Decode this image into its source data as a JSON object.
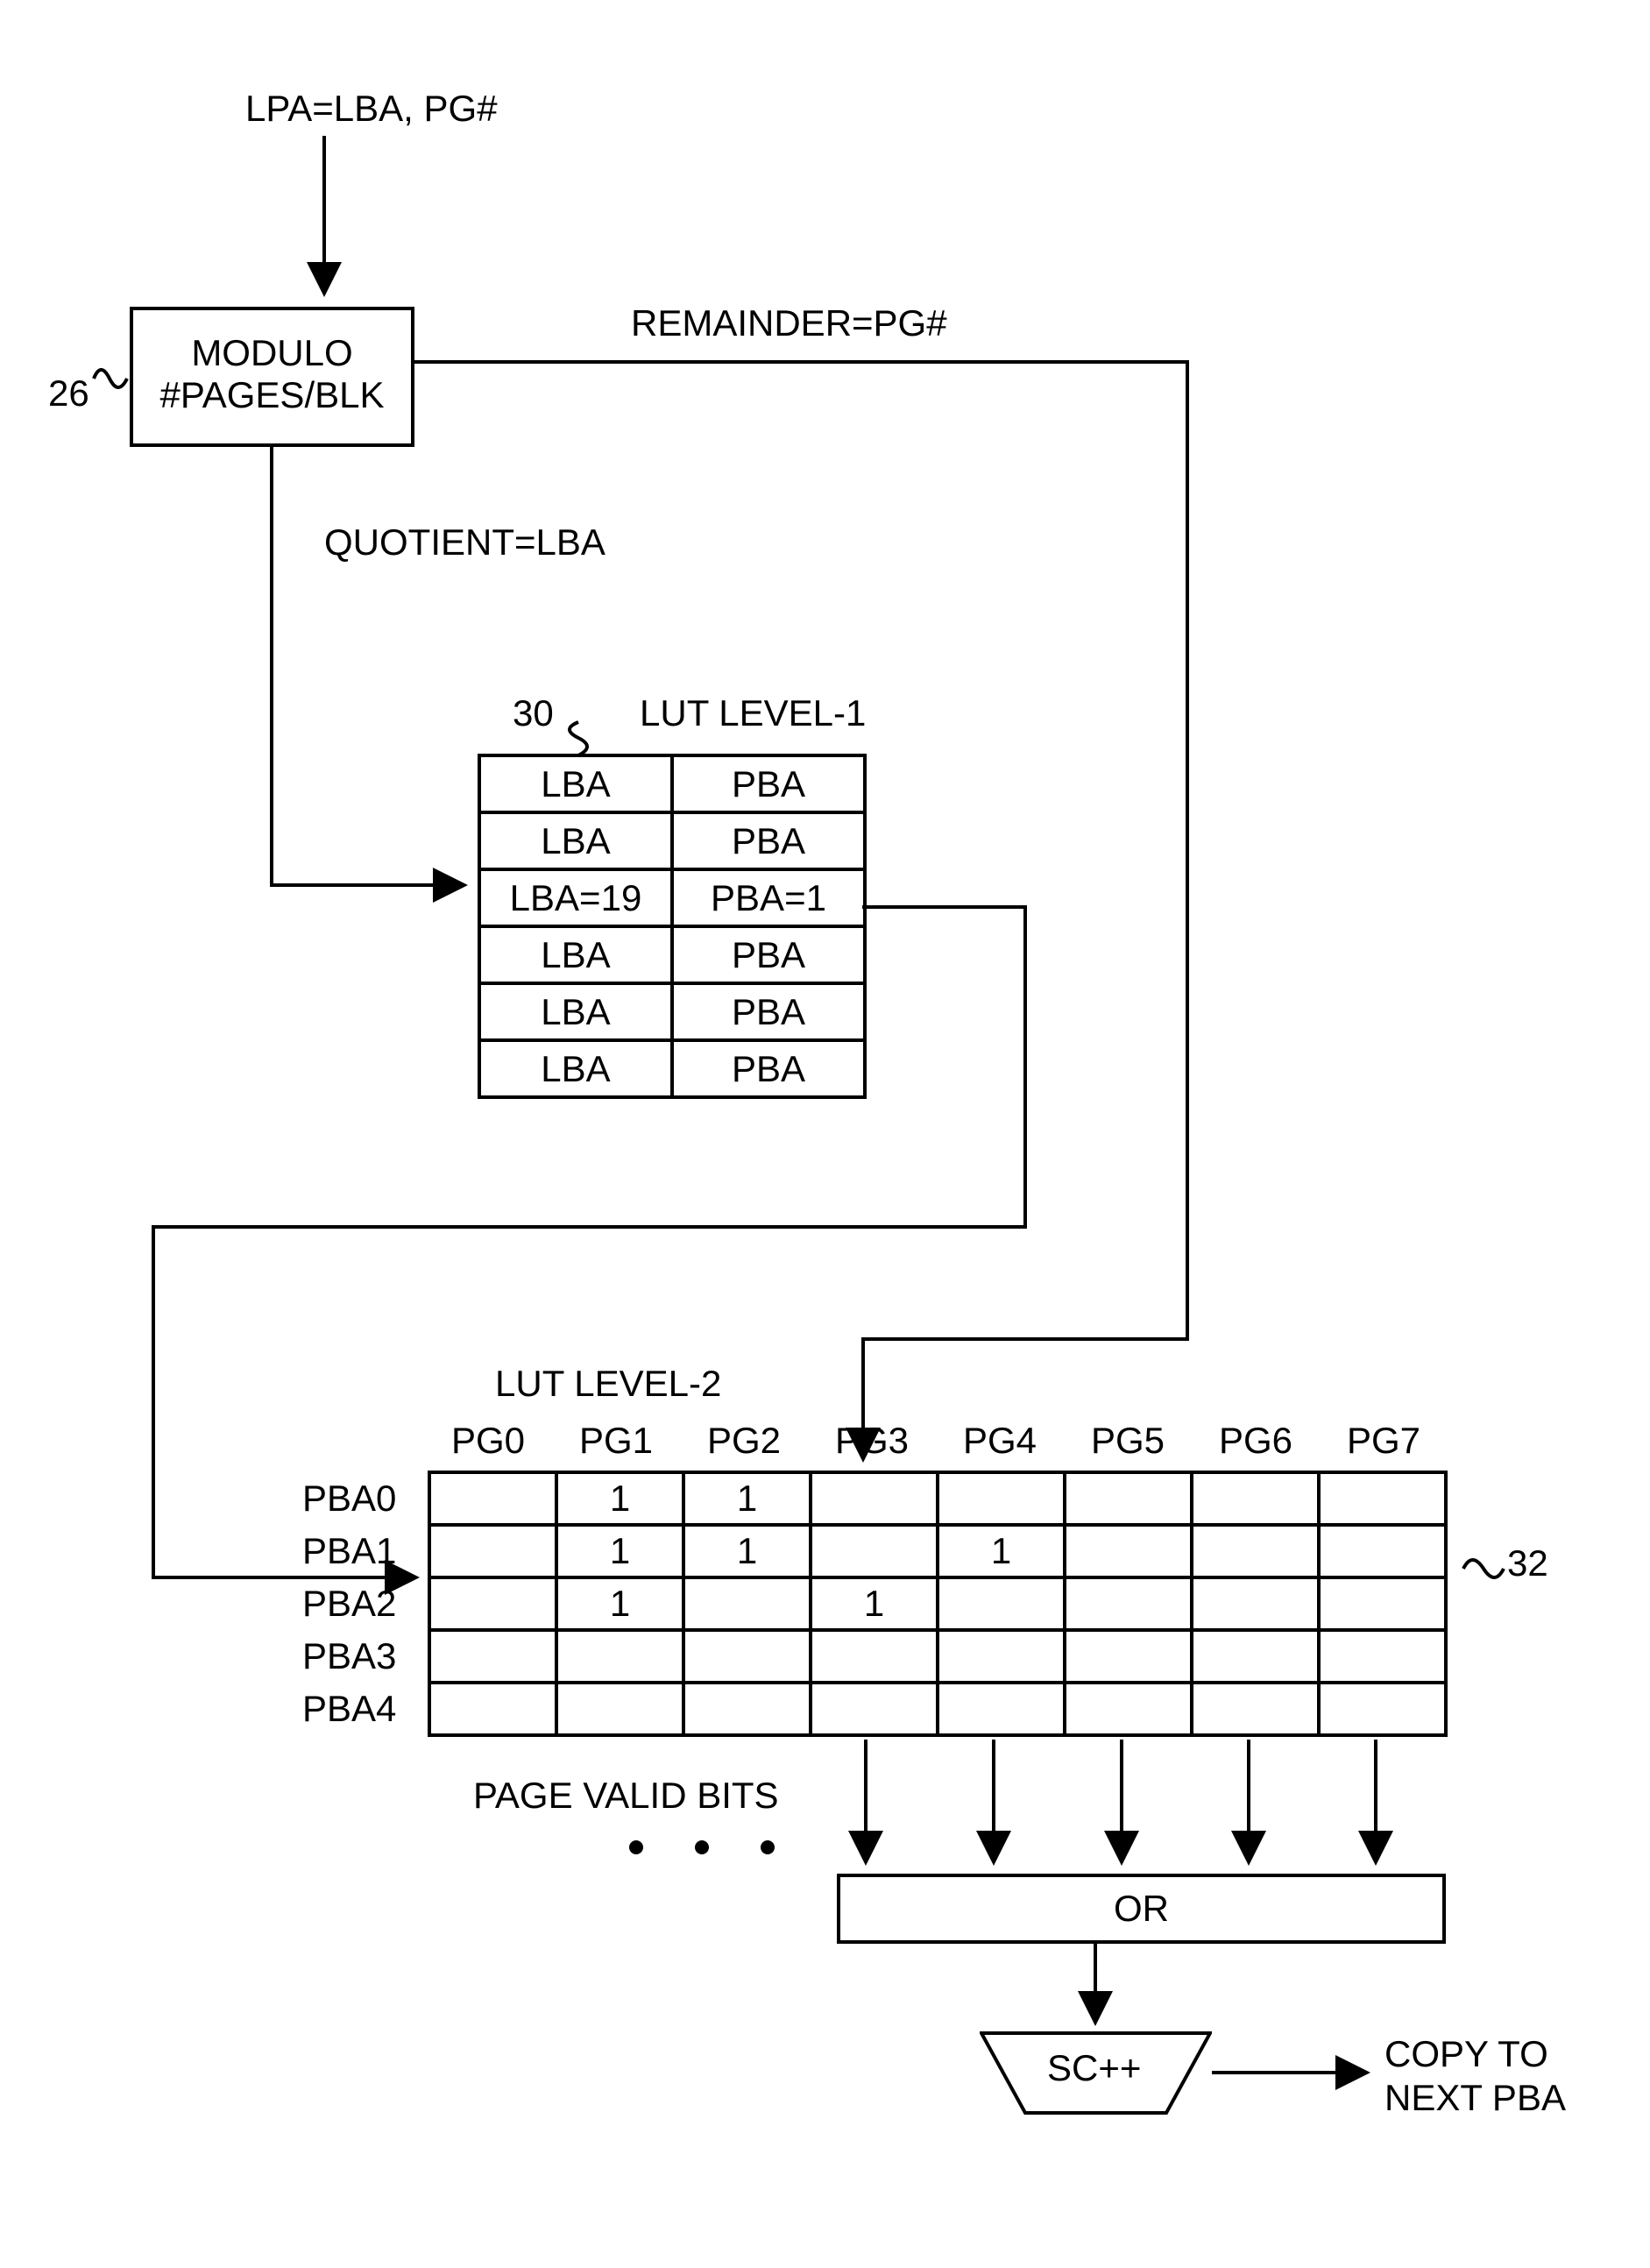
{
  "input_label": "LPA=LBA, PG#",
  "modulo_ref": "26",
  "modulo_line1": "MODULO",
  "modulo_line2": "#PAGES/BLK",
  "remainder_label": "REMAINDER=PG#",
  "quotient_label": "QUOTIENT=LBA",
  "lut1_ref": "30",
  "lut1_title": "LUT LEVEL-1",
  "lut1_rows": [
    {
      "l": "LBA",
      "p": "PBA"
    },
    {
      "l": "LBA",
      "p": "PBA"
    },
    {
      "l": "LBA=19",
      "p": "PBA=1"
    },
    {
      "l": "LBA",
      "p": "PBA"
    },
    {
      "l": "LBA",
      "p": "PBA"
    },
    {
      "l": "LBA",
      "p": "PBA"
    }
  ],
  "lut2_title": "LUT LEVEL-2",
  "lut2_ref": "32",
  "lut2_headers": [
    "PG0",
    "PG1",
    "PG2",
    "PG3",
    "PG4",
    "PG5",
    "PG6",
    "PG7"
  ],
  "lut2_row_labels": [
    "PBA0",
    "PBA1",
    "PBA2",
    "PBA3",
    "PBA4"
  ],
  "lut2_cells": [
    [
      "",
      "1",
      "1",
      "",
      "",
      "",
      "",
      ""
    ],
    [
      "",
      "1",
      "1",
      "",
      "1",
      "",
      "",
      ""
    ],
    [
      "",
      "1",
      "",
      "1",
      "",
      "",
      "",
      ""
    ],
    [
      "",
      "",
      "",
      "",
      "",
      "",
      "",
      ""
    ],
    [
      "",
      "",
      "",
      "",
      "",
      "",
      "",
      ""
    ]
  ],
  "page_valid_bits_label": "PAGE VALID BITS",
  "or_label": "OR",
  "sc_label": "SC++",
  "copy_label1": "COPY TO",
  "copy_label2": "NEXT PBA"
}
